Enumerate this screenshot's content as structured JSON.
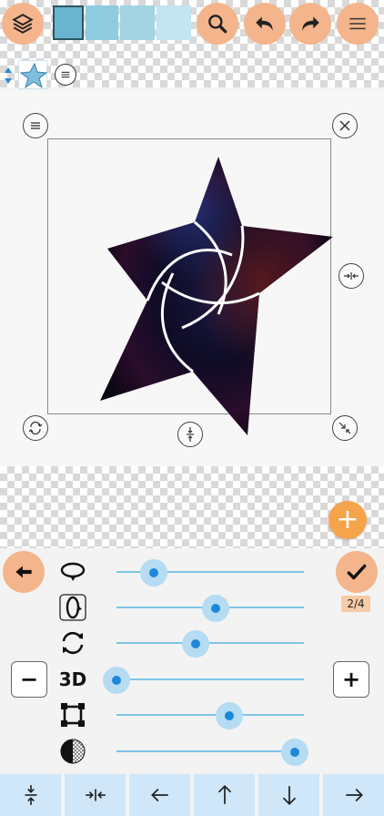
{
  "toolbar": {
    "layers_icon": "layers-icon",
    "swatches": [
      {
        "name": "color-1",
        "color": "#69b5cf",
        "selected": true
      },
      {
        "name": "color-2",
        "color": "#8fcce0"
      },
      {
        "name": "color-3",
        "color": "#a2d4e4"
      },
      {
        "name": "color-4",
        "color": "#c4e4ef"
      }
    ],
    "zoom_icon": "magnifier-icon",
    "undo_icon": "undo-icon",
    "redo_icon": "redo-icon",
    "menu_icon": "hamburger-icon"
  },
  "layer_row": {
    "arrows_icon": "updown-arrows-icon",
    "thumb_icon": "star-thumbnail-icon",
    "menu_icon": "circle-menu-icon"
  },
  "canvas": {
    "handles": [
      "menu-icon",
      "close-icon",
      "compress-horizontal-icon",
      "rotate-icon",
      "compress-vertical-icon",
      "scale-diagonal-icon"
    ]
  },
  "panel": {
    "page_indicator": "2/4",
    "label_3d": "3D",
    "minus_label": "−",
    "plus_label": "+",
    "sliders": [
      {
        "name": "rotate-x",
        "icon": "rotate-horizontal-icon",
        "value": 0.2
      },
      {
        "name": "rotate-y",
        "icon": "rotate-vertical-icon",
        "value": 0.53
      },
      {
        "name": "rotate-z",
        "icon": "rotate-circular-icon",
        "value": 0.42
      },
      {
        "name": "depth-3d",
        "icon": "3d-label",
        "value": 0.0
      },
      {
        "name": "scale",
        "icon": "scale-box-icon",
        "value": 0.6
      },
      {
        "name": "opacity",
        "icon": "opacity-icon",
        "value": 0.95
      }
    ]
  },
  "bottom_nav": {
    "items": [
      "compress-vertical-icon",
      "compress-horizontal-icon",
      "arrow-left-icon",
      "arrow-up-icon",
      "arrow-down-icon",
      "arrow-right-icon"
    ]
  },
  "colors": {
    "accent": "#f4b48c",
    "slider_thumb": "#1e88d8",
    "nav_bg": "#cfe7f8",
    "add_button": "#f5a44c"
  }
}
